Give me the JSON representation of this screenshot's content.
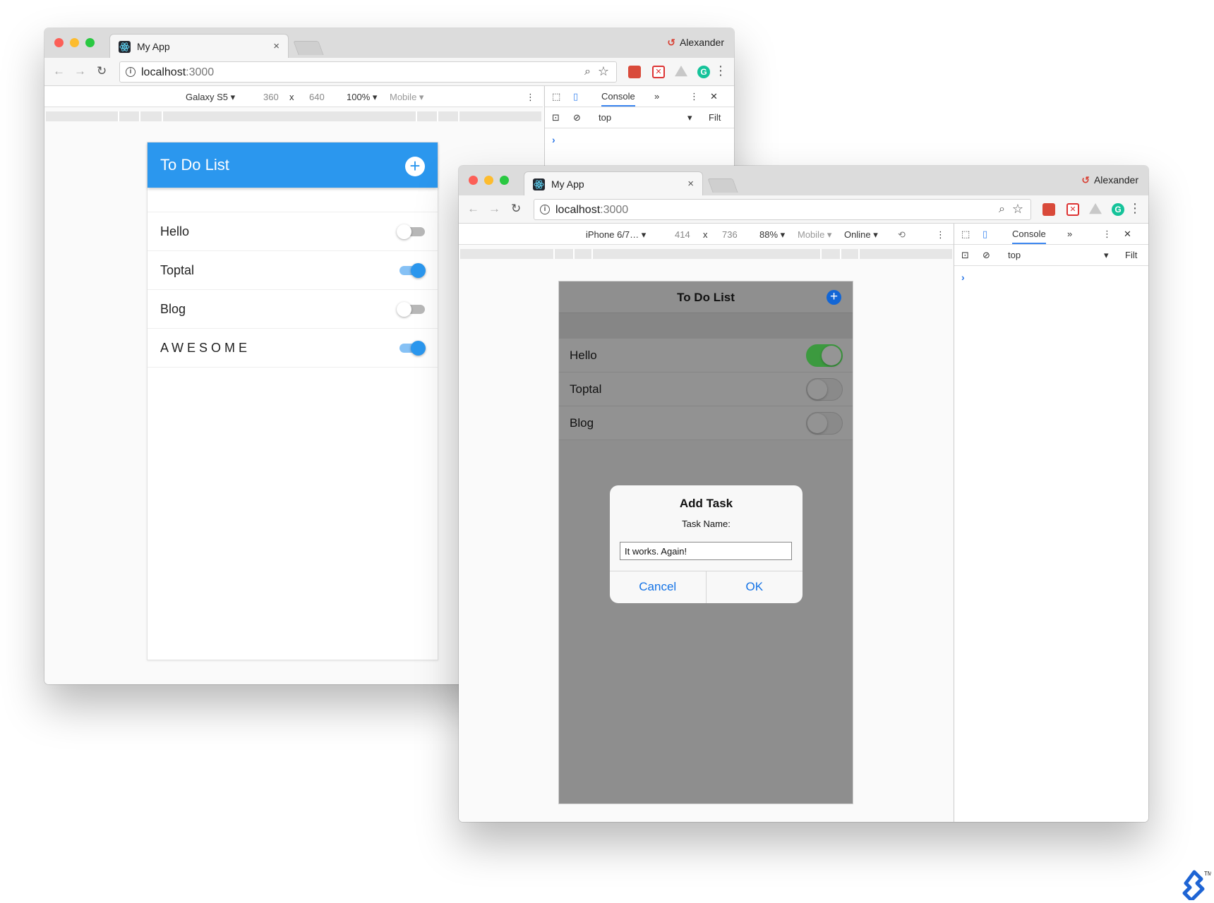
{
  "window1": {
    "tab_title": "My App",
    "tab_close": "×",
    "profile_name": "Alexander",
    "url_host": "localhost",
    "url_port": ":3000",
    "device": "Galaxy S5 ▾",
    "width": "360",
    "times": "x",
    "height": "640",
    "zoom": "100% ▾",
    "mode": "Mobile ▾",
    "devtools_tab": "Console",
    "more_tabs": "»",
    "context": "top",
    "context_arrow": "▾",
    "filter_placeholder": "Filt",
    "prompt": "›",
    "app": {
      "title": "To Do List",
      "add_symbol": "+",
      "tasks": [
        {
          "label": "Hello",
          "done": false
        },
        {
          "label": "Toptal",
          "done": true
        },
        {
          "label": "Blog",
          "done": false
        },
        {
          "label": "A W E S O M E",
          "done": true
        }
      ]
    }
  },
  "window2": {
    "tab_title": "My App",
    "tab_close": "×",
    "profile_name": "Alexander",
    "url_host": "localhost",
    "url_port": ":3000",
    "device": "iPhone 6/7… ▾",
    "width": "414",
    "times": "x",
    "height": "736",
    "zoom": "88% ▾",
    "mode": "Mobile ▾",
    "network": "Online ▾",
    "devtools_tab": "Console",
    "more_tabs": "»",
    "context": "top",
    "context_arrow": "▾",
    "filter_placeholder": "Filt",
    "prompt": "›",
    "app": {
      "title": "To Do List",
      "add_symbol": "+",
      "tasks": [
        {
          "label": "Hello",
          "done": true
        },
        {
          "label": "Toptal",
          "done": false
        },
        {
          "label": "Blog",
          "done": false
        }
      ],
      "dialog": {
        "title": "Add Task",
        "message": "Task Name:",
        "input_value": "It works. Again!",
        "cancel_label": "Cancel",
        "ok_label": "OK"
      }
    }
  },
  "colors": {
    "material_blue": "#2b97ee",
    "ios_green": "#3c9a3f",
    "ios_blue": "#1473e6"
  }
}
